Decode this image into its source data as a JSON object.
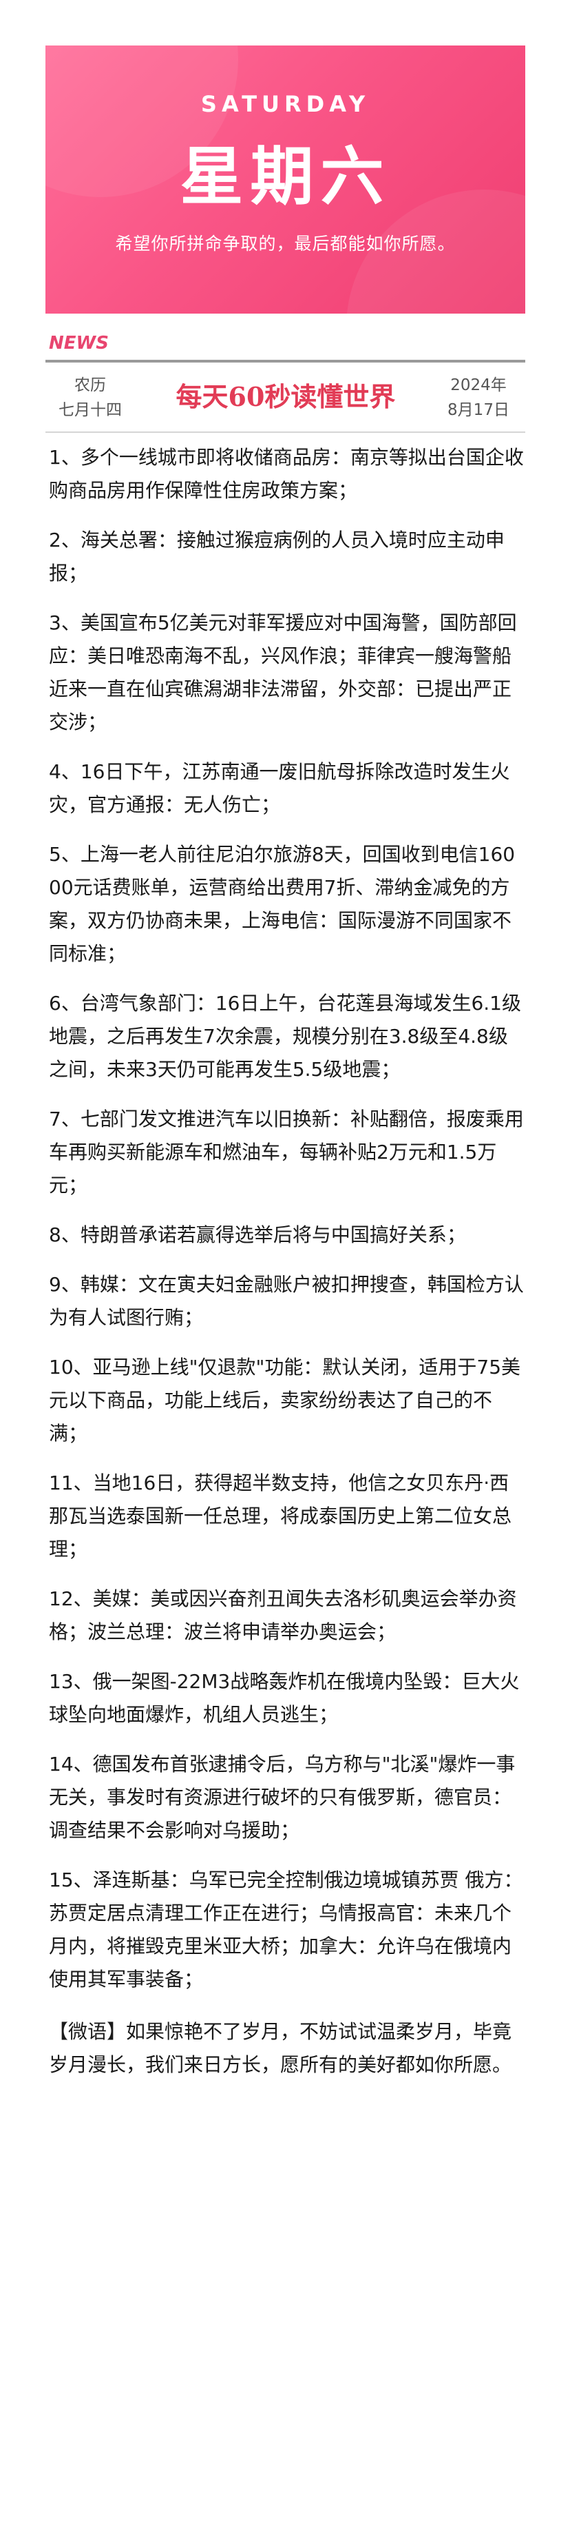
{
  "banner": {
    "weekday_en": "SATURDAY",
    "weekday_cn": "星期六",
    "motto": "希望你所拼命争取的，最后都能如你所愿。"
  },
  "header": {
    "tag": "NEWS",
    "lunar_line1": "农历",
    "lunar_line2": "七月十四",
    "title": "每天60秒读懂世界",
    "date_line1": "2024年",
    "date_line2": "8月17日"
  },
  "news_items": [
    "1、多个一线城市即将收储商品房：南京等拟出台国企收购商品房用作保障性住房政策方案；",
    "2、海关总署：接触过猴痘病例的人员入境时应主动申报；",
    "3、美国宣布5亿美元对菲军援应对中国海警，国防部回应：美日唯恐南海不乱，兴风作浪；菲律宾一艘海警船近来一直在仙宾礁潟湖非法滞留，外交部：已提出严正交涉；",
    "4、16日下午，江苏南通一废旧航母拆除改造时发生火灾，官方通报：无人伤亡；",
    "5、上海一老人前往尼泊尔旅游8天，回国收到电信16000元话费账单，运营商给出费用7折、滞纳金减免的方案，双方仍协商未果，上海电信：国际漫游不同国家不同标准；",
    "6、台湾气象部门：16日上午，台花莲县海域发生6.1级地震，之后再发生7次余震，规模分别在3.8级至4.8级之间，未来3天仍可能再发生5.5级地震；",
    "7、七部门发文推进汽车以旧换新：补贴翻倍，报废乘用车再购买新能源车和燃油车，每辆补贴2万元和1.5万元；",
    "8、特朗普承诺若赢得选举后将与中国搞好关系；",
    "9、韩媒：文在寅夫妇金融账户被扣押搜查，韩国检方认为有人试图行贿；",
    "10、亚马逊上线\"仅退款\"功能：默认关闭，适用于75美元以下商品，功能上线后，卖家纷纷表达了自己的不满；",
    "11、当地16日，获得超半数支持，他信之女贝东丹·西那瓦当选泰国新一任总理，将成泰国历史上第二位女总理；",
    "12、美媒：美或因兴奋剂丑闻失去洛杉矶奥运会举办资格；波兰总理：波兰将申请举办奥运会；",
    "13、俄一架图-22M3战略轰炸机在俄境内坠毁：巨大火球坠向地面爆炸，机组人员逃生；",
    "14、德国发布首张逮捕令后，乌方称与\"北溪\"爆炸一事无关，事发时有资源进行破坏的只有俄罗斯，德官员：调查结果不会影响对乌援助；",
    "15、泽连斯基：乌军已完全控制俄边境城镇苏贾 俄方：苏贾定居点清理工作正在进行；乌情报高官：未来几个月内，将摧毁克里米亚大桥；加拿大：允许乌在俄境内使用其军事装备；"
  ],
  "closing": "【微语】如果惊艳不了岁月，不妨试试温柔岁月，毕竟岁月漫长，我们来日方长，愿所有的美好都如你所愿。"
}
